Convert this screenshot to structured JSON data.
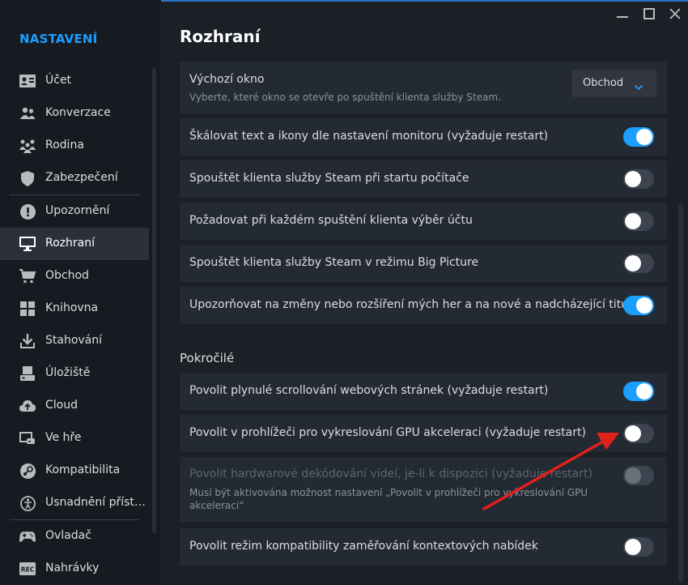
{
  "sidebar": {
    "title": "NASTAVENÍ",
    "items": [
      {
        "label": "Účet",
        "icon": "account-card-icon"
      },
      {
        "label": "Konverzace",
        "icon": "people-icon"
      },
      {
        "label": "Rodina",
        "icon": "family-icon"
      },
      {
        "label": "Zabezpečení",
        "icon": "shield-icon"
      },
      {
        "label": "Upozornění",
        "icon": "exclamation-icon"
      },
      {
        "label": "Rozhraní",
        "icon": "monitor-icon"
      },
      {
        "label": "Obchod",
        "icon": "cart-icon"
      },
      {
        "label": "Knihovna",
        "icon": "grid-icon"
      },
      {
        "label": "Stahování",
        "icon": "download-icon"
      },
      {
        "label": "Úložiště",
        "icon": "drive-icon"
      },
      {
        "label": "Cloud",
        "icon": "cloud-icon"
      },
      {
        "label": "Ve hře",
        "icon": "in-game-icon"
      },
      {
        "label": "Kompatibilita",
        "icon": "steam-icon"
      },
      {
        "label": "Usnadnění příst…",
        "icon": "accessibility-icon"
      },
      {
        "label": "Ovladač",
        "icon": "gamepad-icon"
      },
      {
        "label": "Nahrávky",
        "icon": "rec-icon"
      }
    ],
    "active": "Rozhraní"
  },
  "main": {
    "title": "Rozhraní",
    "default_window": {
      "label": "Výchozí okno",
      "description": "Vyberte, které okno se otevře po spuštění klienta služby Steam.",
      "selected": "Obchod"
    },
    "toggles": [
      {
        "label": "Škálovat text a ikony dle nastavení monitoru (vyžaduje restart)",
        "on": true
      },
      {
        "label": "Spouštět klienta služby Steam při startu počítače",
        "on": false
      },
      {
        "label": "Požadovat při každém spuštění klienta výběr účtu",
        "on": false
      },
      {
        "label": "Spouštět klienta služby Steam v režimu Big Picture",
        "on": false
      },
      {
        "label": "Upozorňovat na změny nebo rozšíření mých her a na nové a nadcházející tituly",
        "on": true
      }
    ],
    "advanced_title": "Pokročilé",
    "advanced": [
      {
        "label": "Povolit plynulé scrollování webových stránek (vyžaduje restart)",
        "on": true
      },
      {
        "label": "Povolit v prohlížeči pro vykreslování GPU akceleraci (vyžaduje restart)",
        "on": false
      },
      {
        "label": "Povolit hardwarové dekódování videí, je-li k dispozici (vyžaduje restart)",
        "on": false,
        "disabled": true,
        "description": "Musí být aktivována možnost nastavení „Povolit v prohlížeči pro vykreslování GPU akceleraci“"
      },
      {
        "label": "Povolit režim kompatibility zaměřování kontextových nabídek",
        "on": false
      }
    ]
  },
  "colors": {
    "accent": "#1a9fff",
    "annotation_arrow": "#e0201c"
  }
}
